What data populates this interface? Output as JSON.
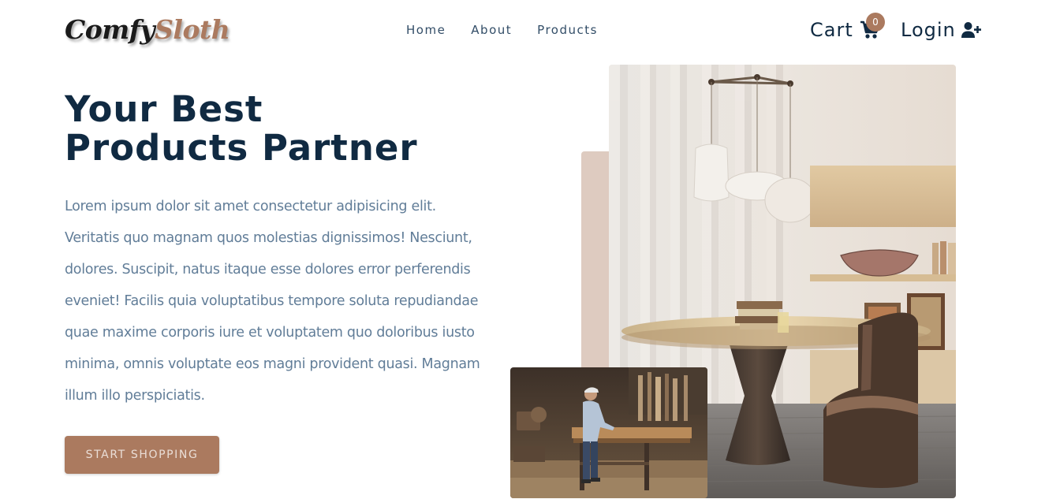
{
  "navbar": {
    "logo_part1": "Comfy",
    "logo_part2": "Sloth",
    "links": [
      "Home",
      "About",
      "Products"
    ],
    "cart_label": "Cart",
    "cart_count": "0",
    "login_label": "Login"
  },
  "hero": {
    "title_line1": "Your Best",
    "title_line2": "Products Partner",
    "description": "Lorem ipsum dolor sit amet consectetur adipisicing elit. Veritatis quo magnam quos molestias dignissimos! Nesciunt, dolores. Suscipit, natus itaque esse dolores error perferendis eveniet! Facilis quia voluptatibus tempore soluta repudiandae quae maxime corporis iure et voluptatem quo doloribus iusto minima, omnis voluptate eos magni provident quasi. Magnam illum illo perspiciatis.",
    "button_label": "START SHOPPING"
  },
  "colors": {
    "primary": "#ab7a5f",
    "heading": "#102a42",
    "body_text": "#617d98",
    "accent_block": "#decbc0"
  },
  "icons": {
    "cart": "cart-icon",
    "login": "user-plus-icon"
  }
}
